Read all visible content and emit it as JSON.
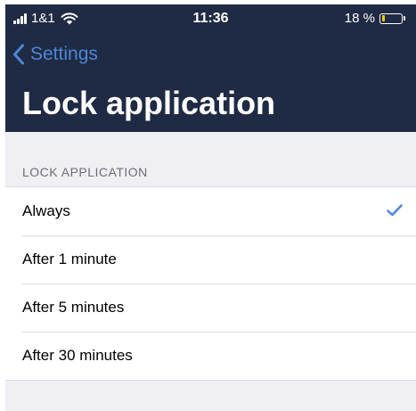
{
  "status_bar": {
    "carrier": "1&1",
    "time": "11:36",
    "battery_percent_text": "18 %",
    "battery_level": 0.18,
    "battery_color": "#ffcc00"
  },
  "nav": {
    "back_label": "Settings",
    "back_icon": "chevron-left-icon",
    "title": "Lock application"
  },
  "section": {
    "header": "LOCK APPLICATION",
    "options": [
      {
        "label": "Always",
        "selected": true
      },
      {
        "label": "After 1 minute",
        "selected": false
      },
      {
        "label": "After 5 minutes",
        "selected": false
      },
      {
        "label": "After 30 minutes",
        "selected": false
      }
    ]
  },
  "colors": {
    "header_bg": "#1f2a44",
    "accent": "#4c87d6",
    "grouped_bg": "#efeff4"
  }
}
